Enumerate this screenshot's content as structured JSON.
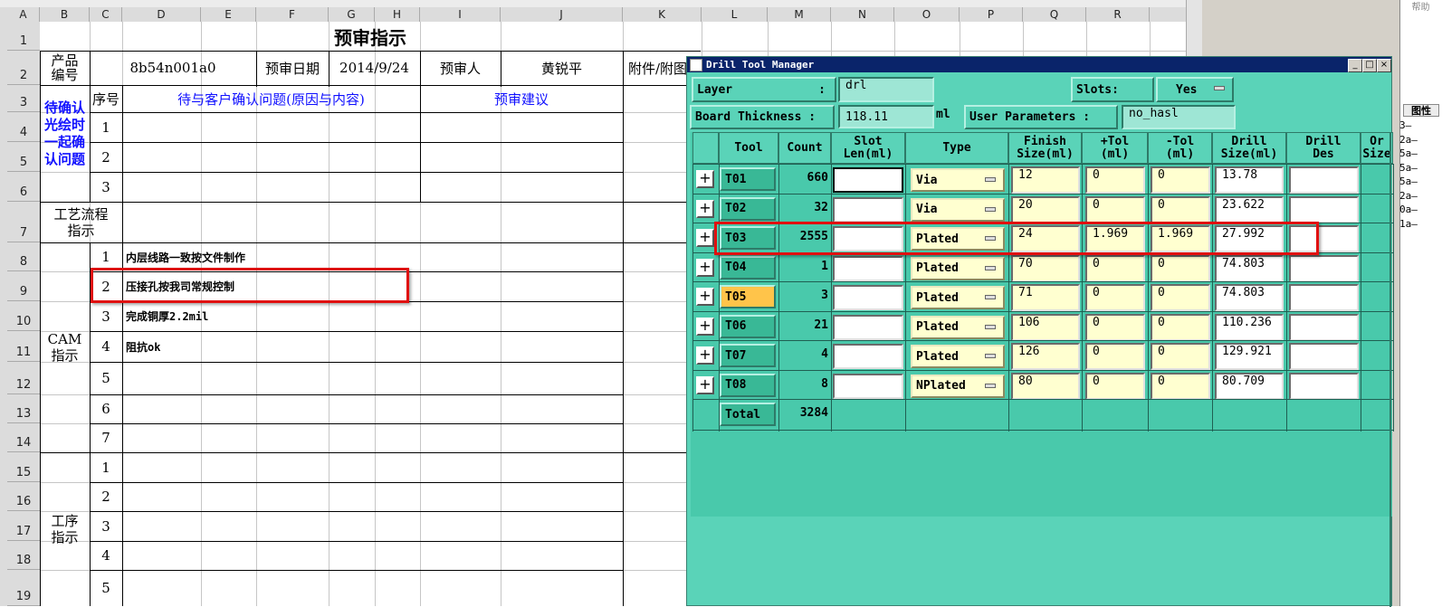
{
  "spreadsheet": {
    "col_headers": [
      "A",
      "B",
      "C",
      "D",
      "E",
      "F",
      "G",
      "H",
      "I",
      "J",
      "K",
      "L",
      "M",
      "N",
      "O",
      "P",
      "Q",
      "R"
    ],
    "row_headers": [
      "1",
      "2",
      "3",
      "4",
      "5",
      "6",
      "7",
      "8",
      "9",
      "10",
      "11",
      "12",
      "13",
      "14",
      "15",
      "16",
      "17",
      "18",
      "19"
    ],
    "title": "预审指示",
    "product_label": "产品\n编号",
    "product_no": "8b54n001a0",
    "date_label": "预审日期",
    "date_value": "2014/9/24",
    "reviewer_label": "预审人",
    "reviewer_name": "黄锐平",
    "attach_label": "附件/附图",
    "seq_label": "序号",
    "issue_header": "待与客户确认问题(原因与内容)",
    "suggest_header": "预审建议",
    "pending_label": "待确认\n光绘时\n一起确\n认问题",
    "pending_rows": [
      "1",
      "2",
      "3"
    ],
    "flow_label": "工艺流程\n指示",
    "cam_label": "CAM\n指示",
    "cam_steps": [
      {
        "n": "1",
        "text": "内层线路一致按文件制作"
      },
      {
        "n": "2",
        "text": "压接孔按我司常规控制"
      },
      {
        "n": "3",
        "text": "完成铜厚2.2mil"
      },
      {
        "n": "4",
        "text": "阻抗ok"
      },
      {
        "n": "5",
        "text": ""
      },
      {
        "n": "6",
        "text": ""
      },
      {
        "n": "7",
        "text": ""
      }
    ],
    "proc_label": "工序\n指示",
    "proc_rows": [
      "1",
      "2",
      "3",
      "4",
      "5"
    ],
    "right_panel": [
      "3—",
      "2a—",
      "5a—",
      "5a—",
      "5a—",
      "2a—",
      "0a—",
      "1a—"
    ],
    "right_top": "帮助",
    "right_tab": "图性"
  },
  "drill_tool_manager": {
    "title": "Drill Tool Manager",
    "layer_label": "Layer",
    "layer_value": "drl",
    "slots_label": "Slots:",
    "slots_value": "Yes",
    "thickness_label": "Board Thickness :",
    "thickness_value": "118.11",
    "thickness_unit": "ml",
    "user_params_label": "User Parameters :",
    "user_params_value": "no_hasl",
    "columns": [
      "Tool",
      "Count",
      "Slot\nLen(ml)",
      "Type",
      "Finish\nSize(ml)",
      "+Tol\n(ml)",
      "-Tol\n(ml)",
      "Drill\nSize(ml)",
      "Drill\nDes",
      "Or\nSize"
    ],
    "tools": [
      {
        "tool": "T01",
        "count": "660",
        "type": "Via",
        "finish": "12",
        "ptol": "0",
        "ntol": "0",
        "drill": "13.78"
      },
      {
        "tool": "T02",
        "count": "32",
        "type": "Via",
        "finish": "20",
        "ptol": "0",
        "ntol": "0",
        "drill": "23.622"
      },
      {
        "tool": "T03",
        "count": "2555",
        "type": "Plated",
        "finish": "24",
        "ptol": "1.969",
        "ntol": "1.969",
        "drill": "27.992"
      },
      {
        "tool": "T04",
        "count": "1",
        "type": "Plated",
        "finish": "70",
        "ptol": "0",
        "ntol": "0",
        "drill": "74.803"
      },
      {
        "tool": "T05",
        "count": "3",
        "type": "Plated",
        "finish": "71",
        "ptol": "0",
        "ntol": "0",
        "drill": "74.803"
      },
      {
        "tool": "T06",
        "count": "21",
        "type": "Plated",
        "finish": "106",
        "ptol": "0",
        "ntol": "0",
        "drill": "110.236"
      },
      {
        "tool": "T07",
        "count": "4",
        "type": "Plated",
        "finish": "126",
        "ptol": "0",
        "ntol": "0",
        "drill": "129.921"
      },
      {
        "tool": "T08",
        "count": "8",
        "type": "NPlated",
        "finish": "80",
        "ptol": "0",
        "ntol": "0",
        "drill": "80.709"
      }
    ],
    "total_label": "Total",
    "total_count": "3284",
    "selected_tool": "T05"
  }
}
